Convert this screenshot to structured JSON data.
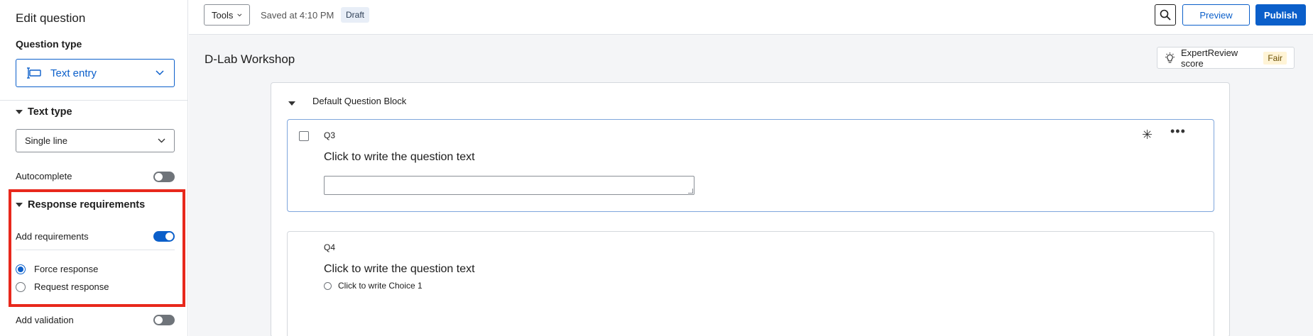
{
  "left_panel": {
    "title": "Edit question",
    "question_type_label": "Question type",
    "question_type_value": "Text entry",
    "text_type_heading": "Text type",
    "text_type_value": "Single line",
    "autocomplete_label": "Autocomplete",
    "autocomplete_on": false,
    "response_requirements_heading": "Response requirements",
    "add_requirements_label": "Add requirements",
    "add_requirements_on": true,
    "radio_options": [
      {
        "label": "Force response",
        "checked": true
      },
      {
        "label": "Request response",
        "checked": false
      }
    ],
    "add_validation_label": "Add validation",
    "add_validation_on": false
  },
  "topbar": {
    "tools_label": "Tools",
    "saved_text": "Saved at 4:10 PM",
    "draft_badge": "Draft",
    "preview_label": "Preview",
    "publish_label": "Publish"
  },
  "main": {
    "survey_title": "D-Lab Workshop",
    "expert_review_label": "ExpertReview score",
    "expert_review_score": "Fair",
    "block_title": "Default Question Block",
    "questions": [
      {
        "id": "Q3",
        "text": "Click to write the question text"
      },
      {
        "id": "Q4",
        "text": "Click to write the question text",
        "choices": [
          "Click to write Choice 1"
        ]
      }
    ]
  },
  "colors": {
    "accent": "#0b5fca",
    "highlight": "#e8281c",
    "background": "#f4f5f7"
  }
}
